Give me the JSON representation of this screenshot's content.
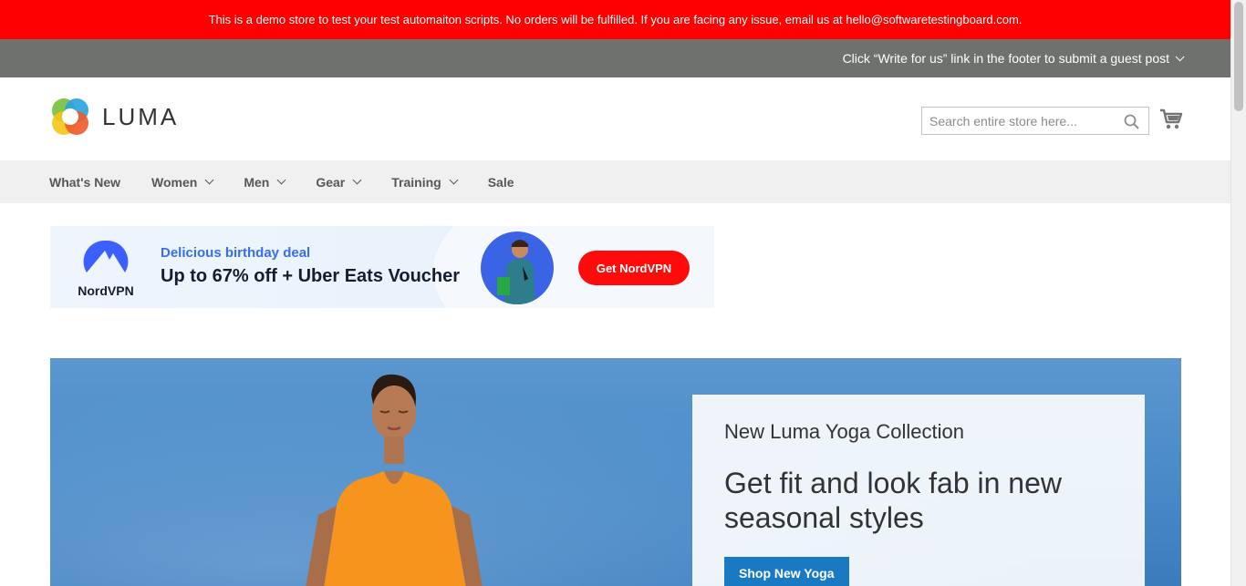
{
  "demo_notice": "This is a demo store to test your test automaiton scripts. No orders will be fulfilled. If you are facing any issue, email us at hello@softwaretestingboard.com.",
  "guest_post_notice": "Click “Write for us” link in the footer to submit a guest post",
  "header": {
    "logo_text": "LUMA",
    "search_placeholder": "Search entire store here...",
    "search_value": ""
  },
  "nav": {
    "items": [
      {
        "label": "What's New",
        "has_dropdown": false
      },
      {
        "label": "Women",
        "has_dropdown": true
      },
      {
        "label": "Men",
        "has_dropdown": true
      },
      {
        "label": "Gear",
        "has_dropdown": true
      },
      {
        "label": "Training",
        "has_dropdown": true
      },
      {
        "label": "Sale",
        "has_dropdown": false
      }
    ]
  },
  "ad": {
    "brand": "NordVPN",
    "sub_heading": "Delicious birthday deal",
    "heading": "Up to 67% off + Uber Eats Voucher",
    "cta_label": "Get NordVPN"
  },
  "hero": {
    "kicker": "New Luma Yoga Collection",
    "headline": "Get fit and look fab in new seasonal styles",
    "button_label": "Shop New Yoga"
  },
  "colors": {
    "demo_bar": "#ff0000",
    "guest_bar": "#6e716e",
    "nav_bg": "#f0f0f0",
    "primary_button": "#1979c3",
    "ad_cta": "#ff0b0b"
  }
}
